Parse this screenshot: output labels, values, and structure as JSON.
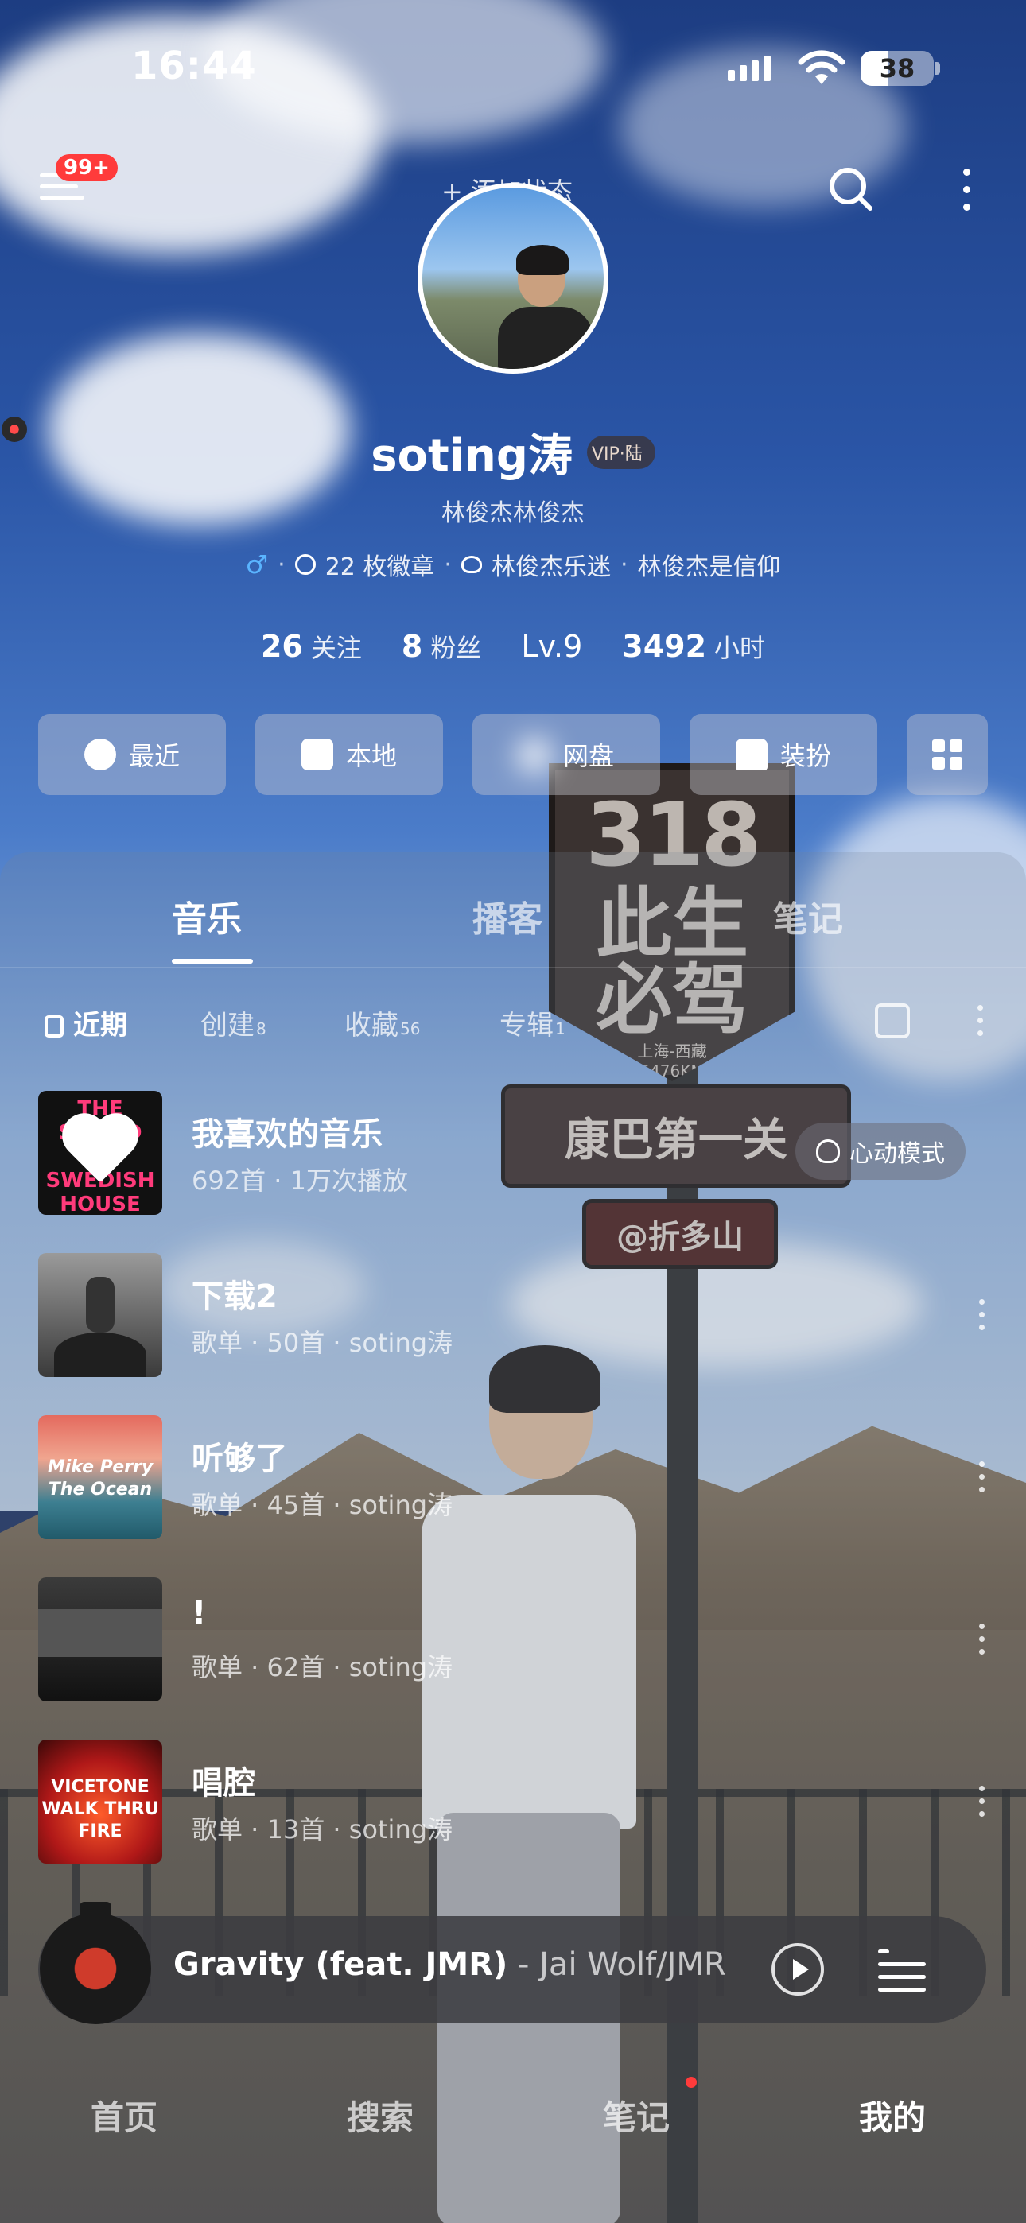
{
  "status_bar": {
    "time": "16:44",
    "battery": "38"
  },
  "top_nav": {
    "notification_badge": "99+",
    "add_status": "+ 添加状态"
  },
  "profile": {
    "username": "soting涛",
    "vip_label": "VIP·陆",
    "subtitle": "林俊杰林俊杰",
    "gender_symbol": "♂",
    "badges": "22 枚徽章",
    "fan_title": "林俊杰乐迷",
    "signature": "林俊杰是信仰",
    "stats": [
      {
        "num": "26",
        "label": "关注"
      },
      {
        "num": "8",
        "label": "粉丝"
      },
      {
        "num": "Lv.9",
        "label": ""
      },
      {
        "num": "3492",
        "label": "小时"
      }
    ]
  },
  "quick_buttons": [
    {
      "label": "最近",
      "icon": "clock-icon"
    },
    {
      "label": "本地",
      "icon": "download-box-icon"
    },
    {
      "label": "网盘",
      "icon": "cloud-upload-icon"
    },
    {
      "label": "装扮",
      "icon": "shirt-icon"
    }
  ],
  "tabs": [
    "音乐",
    "播客",
    "笔记"
  ],
  "filters": [
    {
      "label": "近期",
      "count": ""
    },
    {
      "label": "创建",
      "count": "8"
    },
    {
      "label": "收藏",
      "count": "56"
    },
    {
      "label": "专辑",
      "count": "1"
    }
  ],
  "playlists": [
    {
      "title": "我喜欢的音乐",
      "meta": "692首 · 1万次播放",
      "cover_text": "THE SOUND OF SWEDISH HOUSE"
    },
    {
      "title": "下载2",
      "meta": "歌单 · 50首 · soting涛",
      "cover_text": ""
    },
    {
      "title": "听够了",
      "meta": "歌单 · 45首 · soting涛",
      "cover_text": "Mike Perry The Ocean"
    },
    {
      "title": "!",
      "meta": "歌单 · 62首 · soting涛",
      "cover_text": ""
    },
    {
      "title": "唱腔",
      "meta": "歌单 · 13首 · soting涛",
      "cover_text": "VICETONE WALK THRU FIRE"
    }
  ],
  "heart_mode_label": "心动模式",
  "scene_signs": {
    "sign_318_number": "318",
    "sign_318_text": "此生必驾",
    "sign_318_sub": "上海-西藏",
    "sign_318_km": "5476KM",
    "board_1": "康巴第一关",
    "board_2": "@折多山"
  },
  "mini_player": {
    "song": "Gravity (feat. JMR)",
    "artist": " - Jai Wolf/JMR"
  },
  "bottom_nav": [
    "首页",
    "搜索",
    "笔记",
    "我的"
  ],
  "colors": {
    "accent_red": "#ff3b3b",
    "male_blue": "#5ab4ff"
  }
}
